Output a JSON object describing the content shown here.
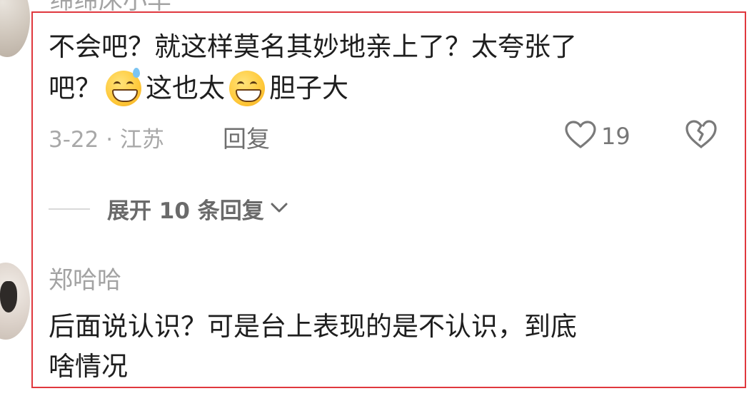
{
  "comment_1": {
    "username": "缔缔床小羊",
    "text_line1": "不会吧？就这样莫名其妙地亲上了？太夸张了",
    "text_line2_a": "吧？",
    "text_line2_b": "这也太",
    "text_line2_c": "胆子大",
    "emoji_1": "grinning-sweat-emoji",
    "emoji_2": "grinning-emoji",
    "date_location": "3-22 · 江苏",
    "reply_label": "回复",
    "like_count": "19",
    "expand_replies_label": "展开 10 条回复"
  },
  "comment_2": {
    "username": "郑哈哈",
    "text_line1": "后面说认识？可是台上表现的是不认识，到底",
    "text_line2": "啥情况"
  },
  "colors": {
    "highlight_border": "#e0383e",
    "meta_text": "#a8a8a8",
    "body_text": "#1e1e1e"
  },
  "icons": {
    "like": "heart-outline-icon",
    "dislike": "broken-heart-icon",
    "expand": "chevron-down-icon"
  }
}
